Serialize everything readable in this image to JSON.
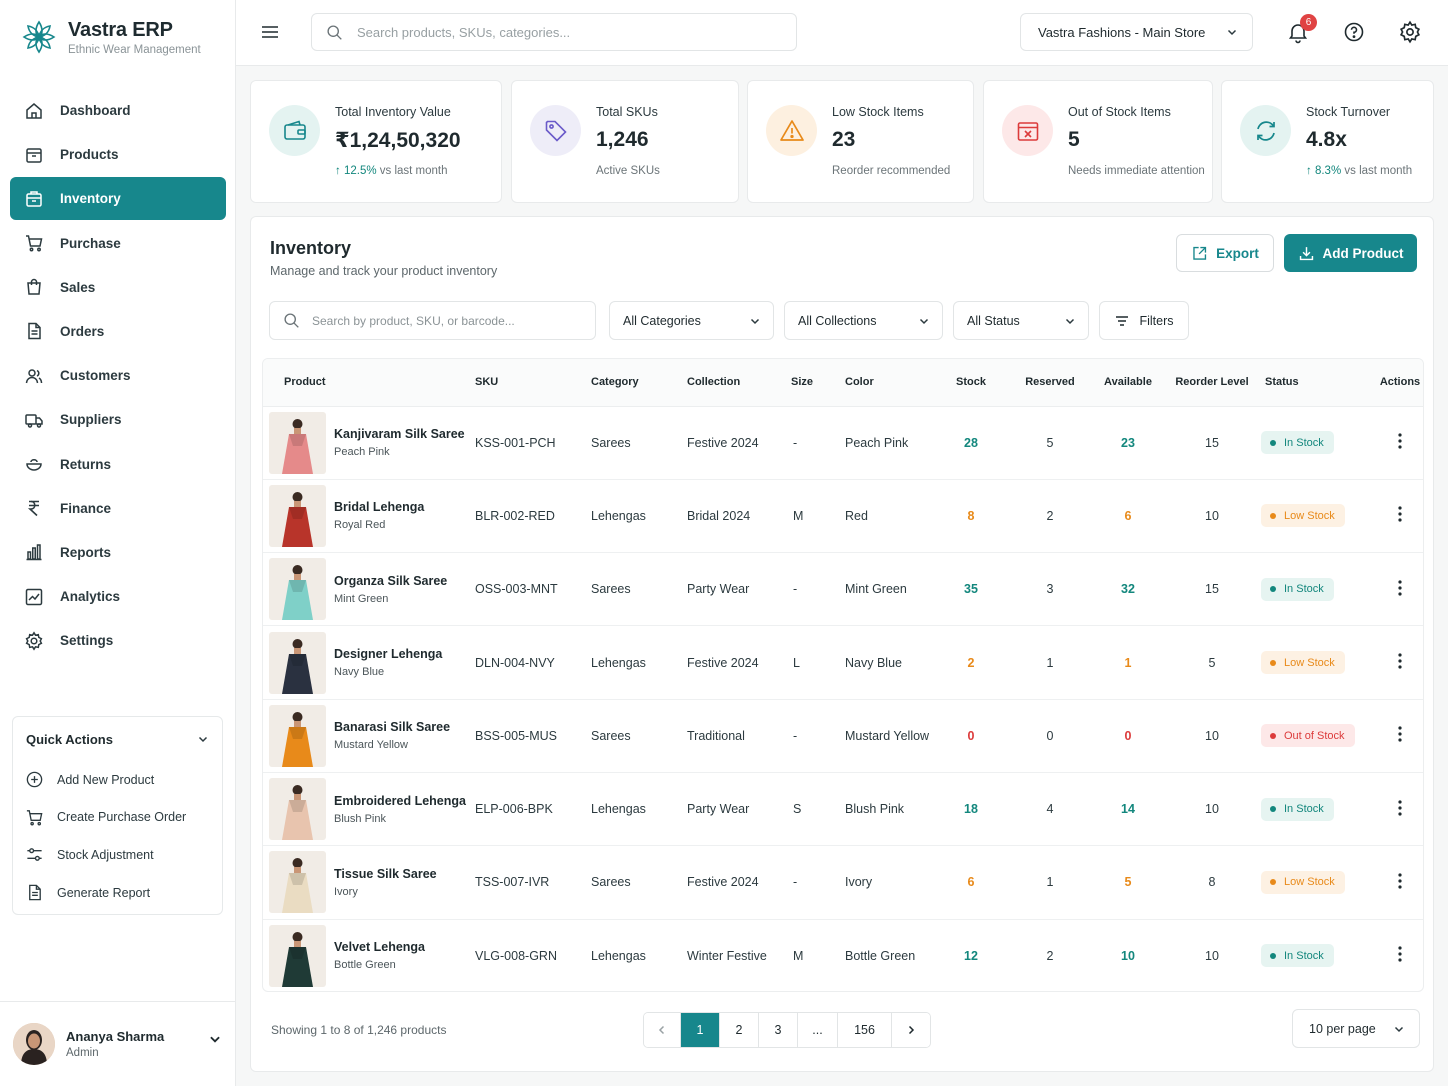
{
  "brand": {
    "name": "Vastra ERP",
    "subtitle": "Ethnic Wear Management"
  },
  "nav": [
    {
      "label": "Dashboard",
      "icon": "home-icon"
    },
    {
      "label": "Products",
      "icon": "box-icon"
    },
    {
      "label": "Inventory",
      "icon": "inventory-icon",
      "active": true
    },
    {
      "label": "Purchase",
      "icon": "cart-icon"
    },
    {
      "label": "Sales",
      "icon": "bag-icon"
    },
    {
      "label": "Orders",
      "icon": "document-icon"
    },
    {
      "label": "Customers",
      "icon": "users-icon"
    },
    {
      "label": "Suppliers",
      "icon": "truck-icon"
    },
    {
      "label": "Returns",
      "icon": "return-icon"
    },
    {
      "label": "Finance",
      "icon": "rupee-icon"
    },
    {
      "label": "Reports",
      "icon": "bar-chart-icon"
    },
    {
      "label": "Analytics",
      "icon": "line-chart-icon"
    },
    {
      "label": "Settings",
      "icon": "gear-icon"
    }
  ],
  "quick_actions": {
    "title": "Quick Actions",
    "items": [
      {
        "label": "Add New Product",
        "icon": "plus-circle-icon"
      },
      {
        "label": "Create Purchase Order",
        "icon": "cart-icon"
      },
      {
        "label": "Stock Adjustment",
        "icon": "sliders-icon"
      },
      {
        "label": "Generate Report",
        "icon": "document-icon"
      }
    ]
  },
  "user": {
    "name": "Ananya Sharma",
    "role": "Admin"
  },
  "topbar": {
    "search_placeholder": "Search products, SKUs, categories...",
    "store": "Vastra Fashions - Main Store",
    "notification_count": "6"
  },
  "stats": [
    {
      "label": "Total Inventory Value",
      "value": "₹1,24,50,320",
      "trend": "12.5%",
      "note": "vs last month",
      "icon": "wallet-icon"
    },
    {
      "label": "Total SKUs",
      "value": "1,246",
      "note": "Active SKUs",
      "icon": "tag-icon"
    },
    {
      "label": "Low Stock Items",
      "value": "23",
      "note": "Reorder recommended",
      "icon": "warning-icon"
    },
    {
      "label": "Out of Stock Items",
      "value": "5",
      "note": "Needs immediate attention",
      "icon": "empty-box-icon"
    },
    {
      "label": "Stock Turnover",
      "value": "4.8x",
      "trend": "8.3%",
      "note": "vs last month",
      "icon": "refresh-icon"
    }
  ],
  "inventory": {
    "title": "Inventory",
    "subtitle": "Manage and track your product inventory",
    "export_label": "Export",
    "add_label": "Add Product",
    "search_placeholder": "Search by product, SKU, or barcode...",
    "filters": {
      "category": "All Categories",
      "collection": "All Collections",
      "status": "All Status",
      "filters_label": "Filters"
    },
    "columns": [
      "Product",
      "SKU",
      "Category",
      "Collection",
      "Size",
      "Color",
      "Stock",
      "Reserved",
      "Available",
      "Reorder Level",
      "Status",
      "Actions"
    ],
    "rows": [
      {
        "name": "Kanjivaram Silk Saree",
        "color_name": "Peach Pink",
        "sku": "KSS-001-PCH",
        "category": "Sarees",
        "collection": "Festive 2024",
        "size": "-",
        "color": "Peach Pink",
        "stock": "28",
        "reserved": "5",
        "available": "23",
        "reorder": "15",
        "status": "In Stock",
        "level": "ok",
        "swatch": "#e58a8a"
      },
      {
        "name": "Bridal Lehenga",
        "color_name": "Royal Red",
        "sku": "BLR-002-RED",
        "category": "Lehengas",
        "collection": "Bridal 2024",
        "size": "M",
        "color": "Red",
        "stock": "8",
        "reserved": "2",
        "available": "6",
        "reorder": "10",
        "status": "Low Stock",
        "level": "low",
        "swatch": "#b8342a"
      },
      {
        "name": "Organza Silk Saree",
        "color_name": "Mint Green",
        "sku": "OSS-003-MNT",
        "category": "Sarees",
        "collection": "Party Wear",
        "size": "-",
        "color": "Mint Green",
        "stock": "35",
        "reserved": "3",
        "available": "32",
        "reorder": "15",
        "status": "In Stock",
        "level": "ok",
        "swatch": "#7fd0c8"
      },
      {
        "name": "Designer Lehenga",
        "color_name": "Navy Blue",
        "sku": "DLN-004-NVY",
        "category": "Lehengas",
        "collection": "Festive 2024",
        "size": "L",
        "color": "Navy Blue",
        "stock": "2",
        "reserved": "1",
        "available": "1",
        "reorder": "5",
        "status": "Low Stock",
        "level": "low",
        "swatch": "#2a3140"
      },
      {
        "name": "Banarasi Silk Saree",
        "color_name": "Mustard Yellow",
        "sku": "BSS-005-MUS",
        "category": "Sarees",
        "collection": "Traditional",
        "size": "-",
        "color": "Mustard Yellow",
        "stock": "0",
        "reserved": "0",
        "available": "0",
        "reorder": "10",
        "status": "Out of Stock",
        "level": "out",
        "swatch": "#e88a1a"
      },
      {
        "name": "Embroidered Lehenga",
        "color_name": "Blush Pink",
        "sku": "ELP-006-BPK",
        "category": "Lehengas",
        "collection": "Party Wear",
        "size": "S",
        "color": "Blush Pink",
        "stock": "18",
        "reserved": "4",
        "available": "14",
        "reorder": "10",
        "status": "In Stock",
        "level": "ok",
        "swatch": "#e8c4ae"
      },
      {
        "name": "Tissue Silk Saree",
        "color_name": "Ivory",
        "sku": "TSS-007-IVR",
        "category": "Sarees",
        "collection": "Festive 2024",
        "size": "-",
        "color": "Ivory",
        "stock": "6",
        "reserved": "1",
        "available": "5",
        "reorder": "8",
        "status": "Low Stock",
        "level": "low",
        "swatch": "#eadcc2"
      },
      {
        "name": "Velvet Lehenga",
        "color_name": "Bottle Green",
        "sku": "VLG-008-GRN",
        "category": "Lehengas",
        "collection": "Winter Festive",
        "size": "M",
        "color": "Bottle Green",
        "stock": "12",
        "reserved": "2",
        "available": "10",
        "reorder": "10",
        "status": "In Stock",
        "level": "ok",
        "swatch": "#1f3a36"
      }
    ],
    "showing": "Showing 1 to 8 of 1,246 products",
    "pages": [
      "1",
      "2",
      "3",
      "...",
      "156"
    ],
    "per_page": "10 per page"
  },
  "colors": {
    "accent": "#17878c",
    "ok": "#13877d",
    "low": "#e88a1a",
    "out": "#dc3b3b"
  }
}
